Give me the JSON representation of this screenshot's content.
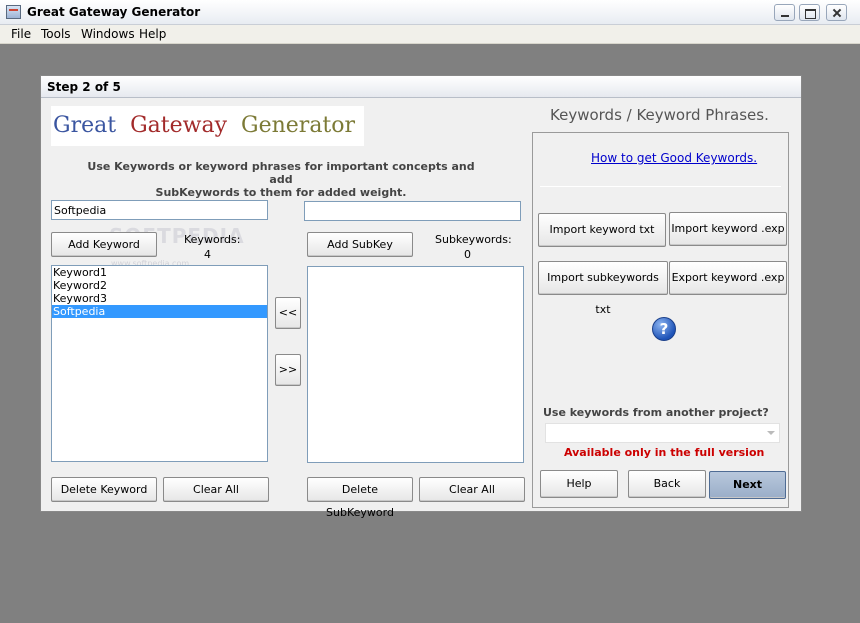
{
  "window": {
    "title": "Great Gateway Generator"
  },
  "menu": {
    "items": [
      "File",
      "Tools",
      "Windows",
      "Help"
    ]
  },
  "dialog": {
    "title": "Step 2 of 5",
    "logo": {
      "word1": "Great",
      "word2": "Gateway",
      "word3": "Generator"
    },
    "instructions_line1": "Use Keywords or keyword phrases for important concepts and add",
    "instructions_line2": "SubKeywords to them for added weight.",
    "keyword_input": {
      "value": "Softpedia",
      "placeholder": ""
    },
    "subkeyword_input": {
      "value": "",
      "placeholder": ""
    },
    "add_keyword_label": "Add Keyword",
    "add_subkey_label": "Add SubKey",
    "keywords_count_label": "Keywords:",
    "keywords_count": "4",
    "subkeywords_count_label": "Subkeywords:",
    "subkeywords_count": "0",
    "keywords": [
      {
        "label": "Keyword1",
        "selected": false
      },
      {
        "label": "Keyword2",
        "selected": false
      },
      {
        "label": "Keyword3",
        "selected": false
      },
      {
        "label": "Softpedia",
        "selected": true
      }
    ],
    "subkeywords": [],
    "move_left_label": "<<",
    "move_right_label": ">>",
    "delete_keyword_label": "Delete Keyword",
    "clear_all_keywords_label": "Clear All",
    "delete_subkeyword_label": "Delete SubKeyword",
    "clear_all_subkeywords_label": "Clear All",
    "watermark": {
      "big": "SOFTPEDIA",
      "small": "www.softpedia.com"
    }
  },
  "right_panel": {
    "heading": "Keywords / Keyword Phrases.",
    "link": "How to get Good Keywords.",
    "import_keyword_txt": "Import keyword txt",
    "import_keyword_exp": "Import keyword .exp",
    "import_subkeywords_txt": "Import subkeywords txt",
    "export_keyword_exp": "Export keyword .exp",
    "help_icon_text": "?",
    "project_label": "Use keywords from another project?",
    "project_combo_value": "",
    "full_version_notice": "Available only in the full version",
    "help_label": "Help",
    "back_label": "Back",
    "next_label": "Next"
  },
  "colors": {
    "selection": "#3399ff",
    "link": "#0000cc",
    "warning": "#cc0000",
    "logo_blue": "#3a55a0",
    "logo_red": "#a22a2a",
    "logo_olive": "#7c7a36"
  }
}
